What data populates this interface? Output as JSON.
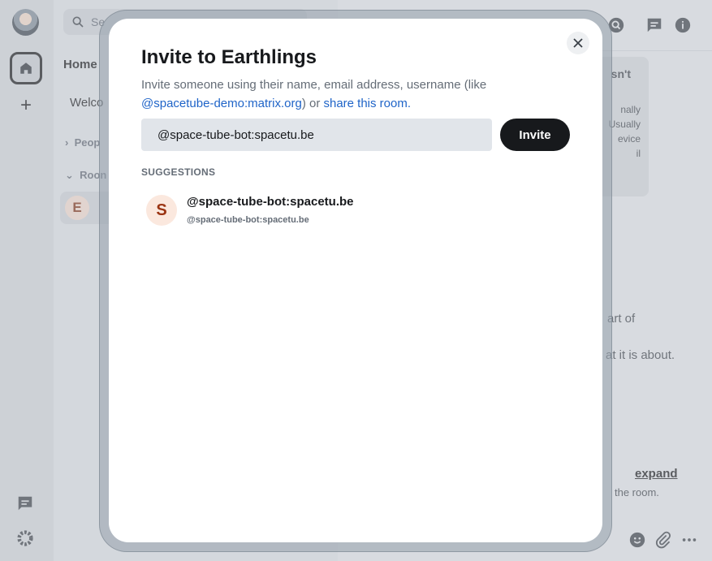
{
  "background": {
    "search": {
      "placeholder_partial": "Se"
    },
    "home_title": "Home",
    "welcome_item": "Welco",
    "sections": {
      "people": "Peop",
      "rooms": "Roon"
    },
    "room_avatar_letter": "E",
    "card": {
      "title_partial": "sn't",
      "lines": [
        "nally",
        "Usually",
        "evice",
        "il"
      ]
    },
    "main_text": {
      "line1": "art of",
      "line2": "at it is about.",
      "expand": "expand",
      "room_line": "the room."
    }
  },
  "dialog": {
    "title": "Invite to Earthlings",
    "description_prefix": "Invite someone using their name, email address, username (like",
    "description_example": "@spacetube-demo:matrix.org",
    "description_or": ") or ",
    "description_share": "share this room.",
    "input_value": "@space-tube-bot:spacetu.be",
    "invite_label": "Invite",
    "suggestions_label": "SUGGESTIONS",
    "suggestions": [
      {
        "avatar_letter": "S",
        "name": "@space-tube-bot:spacetu.be",
        "id": "@space-tube-bot:spacetu.be"
      }
    ]
  },
  "colors": {
    "accent": "#17191c",
    "link": "#1f64c8",
    "avatar_bg": "#fbe8de"
  }
}
